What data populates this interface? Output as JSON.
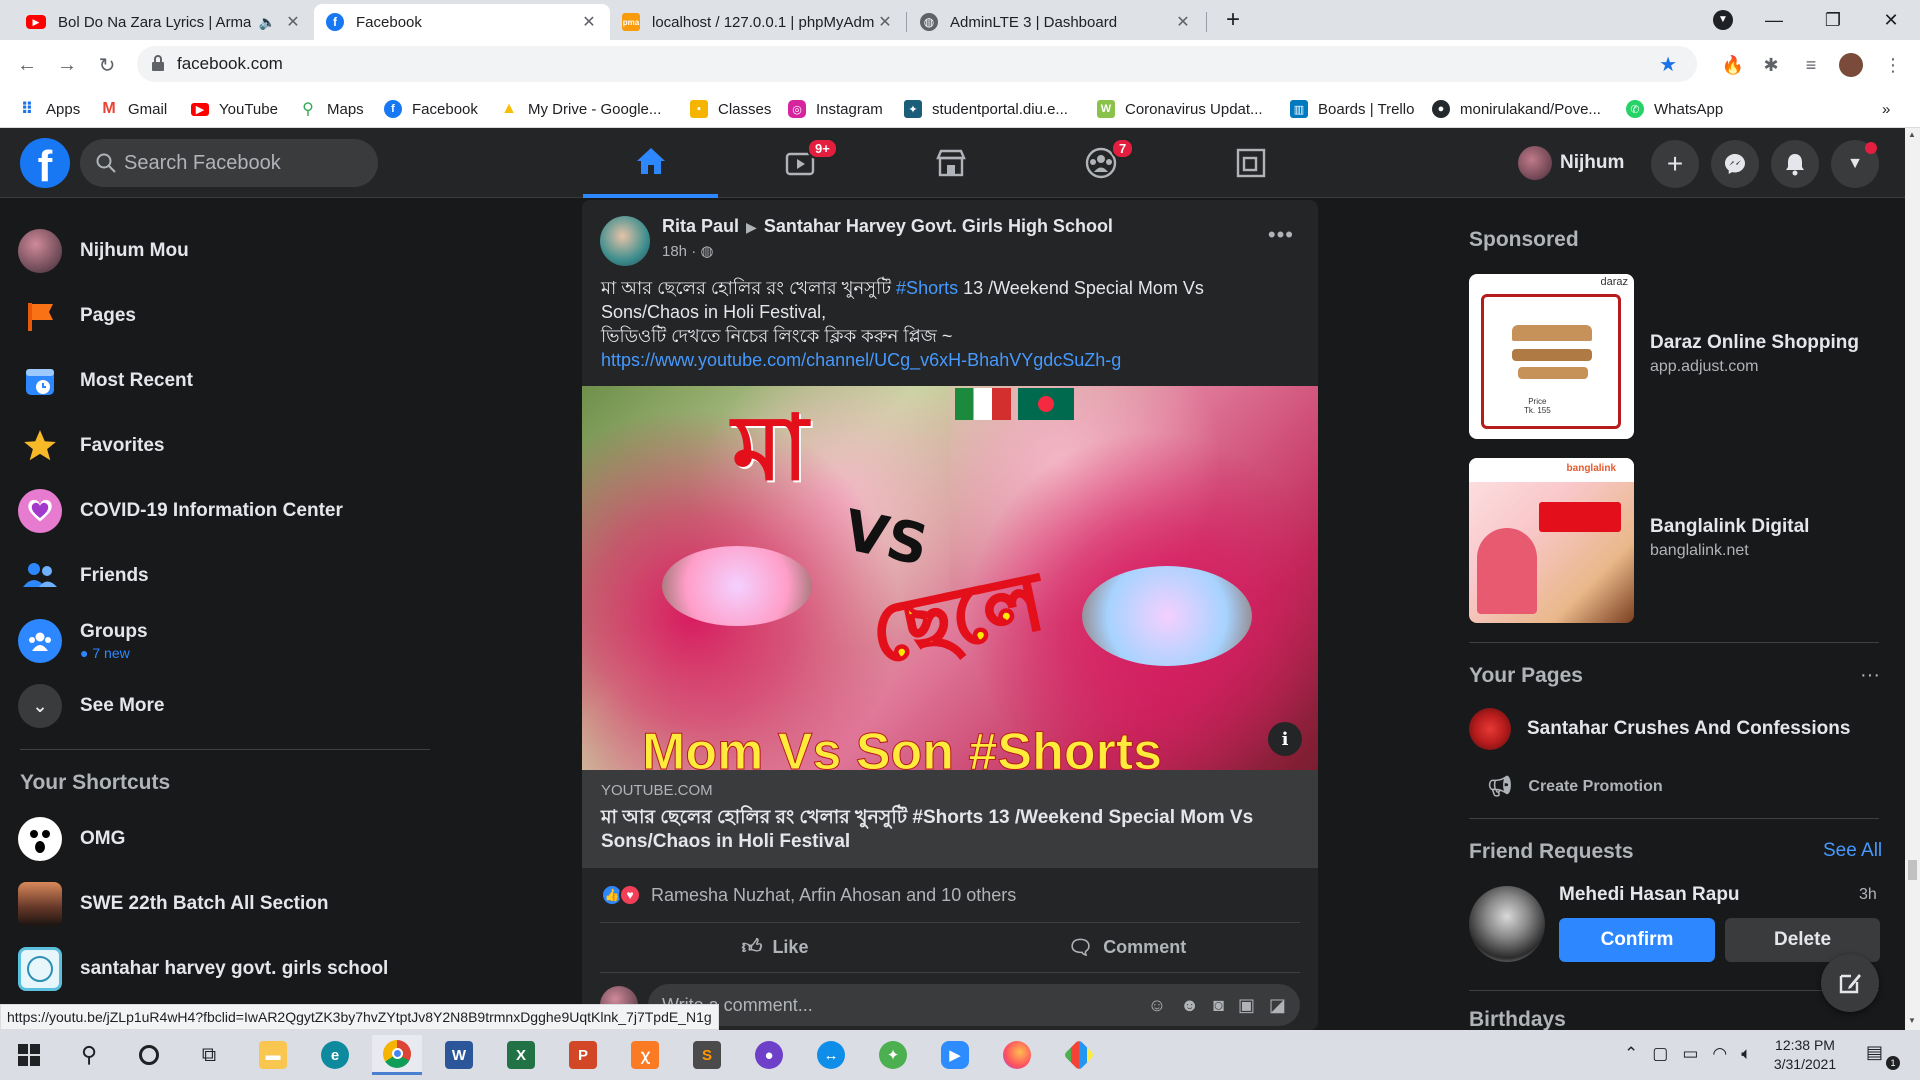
{
  "browser": {
    "tabs": [
      {
        "label": "Bol Do Na Zara Lyrics | Arma",
        "icon": "youtube-icon",
        "muted_icon": "speaker-icon"
      },
      {
        "label": "Facebook",
        "icon": "facebook-icon"
      },
      {
        "label": "localhost / 127.0.0.1 | phpMyAdm",
        "icon": "phpmyadmin-icon"
      },
      {
        "label": "AdminLTE 3 | Dashboard",
        "icon": "globe-icon"
      }
    ],
    "url": "facebook.com",
    "bookmarks": [
      "Apps",
      "Gmail",
      "YouTube",
      "Maps",
      "Facebook",
      "My Drive - Google...",
      "Classes",
      "Instagram",
      "studentportal.diu.e...",
      "Coronavirus Updat...",
      "Boards | Trello",
      "monirulakand/Pove...",
      "WhatsApp"
    ],
    "bookmarks_overflow": "»",
    "status_url": "https://youtu.be/jZLp1uR4wH4?fbclid=IwAR2QgytZK3by7hvZYtptJv8Y2N8B9trmnxDgghe9UqtKlnk_7j7TpdE_N1g"
  },
  "fb": {
    "search_placeholder": "Search Facebook",
    "nav_badges": {
      "watch": "9+",
      "groups": "7"
    },
    "profile_name": "Nijhum",
    "sidebar": {
      "items": [
        {
          "label": "Nijhum Mou",
          "icon": "avatar"
        },
        {
          "label": "Pages",
          "icon": "flag-icon"
        },
        {
          "label": "Most Recent",
          "icon": "clock-icon"
        },
        {
          "label": "Favorites",
          "icon": "star-icon"
        },
        {
          "label": "COVID-19 Information Center",
          "icon": "heart-icon"
        },
        {
          "label": "Friends",
          "icon": "friends-icon"
        },
        {
          "label": "Groups",
          "icon": "groups-icon",
          "sub": "7 new"
        },
        {
          "label": "See More",
          "icon": "chevron-down-icon"
        }
      ],
      "shortcuts_title": "Your Shortcuts",
      "shortcuts": [
        {
          "label": "OMG"
        },
        {
          "label": "SWE 22th Batch All Section"
        },
        {
          "label": "santahar harvey govt. girls school"
        }
      ]
    },
    "post": {
      "author": "Rita Paul",
      "group": "Santahar Harvey Govt. Girls High School",
      "time": "18h",
      "text_line1_a": "মা আর ছেলের হোলির রং খেলার খুনসুটি ",
      "text_hashtag": "#Shorts",
      "text_line1_b": " 13 /Weekend Special Mom Vs Sons/Chaos in Holi   Festival,",
      "text_line2": "ভিডিওটি দেখতে নিচের লিংকে ক্লিক করুন প্লিজ ~",
      "text_link": "https://www.youtube.com/channel/UCg_v6xH-BhahVYgdcSuZh-g",
      "thumb_title_bn1": "মা",
      "thumb_vs": "VS",
      "thumb_title_bn2": "ছেলে",
      "thumb_caption": "Mom Vs Son  #Shorts",
      "link_domain": "YOUTUBE.COM",
      "link_title": "মা আর ছেলের হোলির রং খেলার খুনসুটি #Shorts 13 /Weekend Special Mom Vs Sons/Chaos in Holi Festival",
      "reactions": "Ramesha Nuzhat, Arfin Ahosan and 10 others",
      "like_label": "Like",
      "comment_label": "Comment",
      "comment_placeholder": "Write a comment..."
    },
    "right": {
      "sponsored_title": "Sponsored",
      "ads": [
        {
          "name": "Daraz Online Shopping",
          "domain": "app.adjust.com",
          "img_text": "daraz",
          "price": "Price\nTk. 155"
        },
        {
          "name": "Banglalink Digital",
          "domain": "banglalink.net",
          "img_text": "banglalink"
        }
      ],
      "your_pages_title": "Your Pages",
      "page_name": "Santahar Crushes And Confessions",
      "create_promotion": "Create Promotion",
      "friend_requests_title": "Friend Requests",
      "see_all": "See All",
      "request": {
        "name": "Mehedi Hasan Rapu",
        "time": "3h",
        "confirm": "Confirm",
        "delete": "Delete"
      },
      "birthdays_title": "Birthdays"
    }
  },
  "taskbar": {
    "time": "12:38 PM",
    "date": "3/31/2021",
    "notification_count": "1"
  },
  "colors": {
    "fb_blue": "#1877f2",
    "fb_dark_bg": "#18191a",
    "fb_card": "#242526",
    "link_blue": "#4599ff",
    "badge_red": "#e41e3f"
  }
}
